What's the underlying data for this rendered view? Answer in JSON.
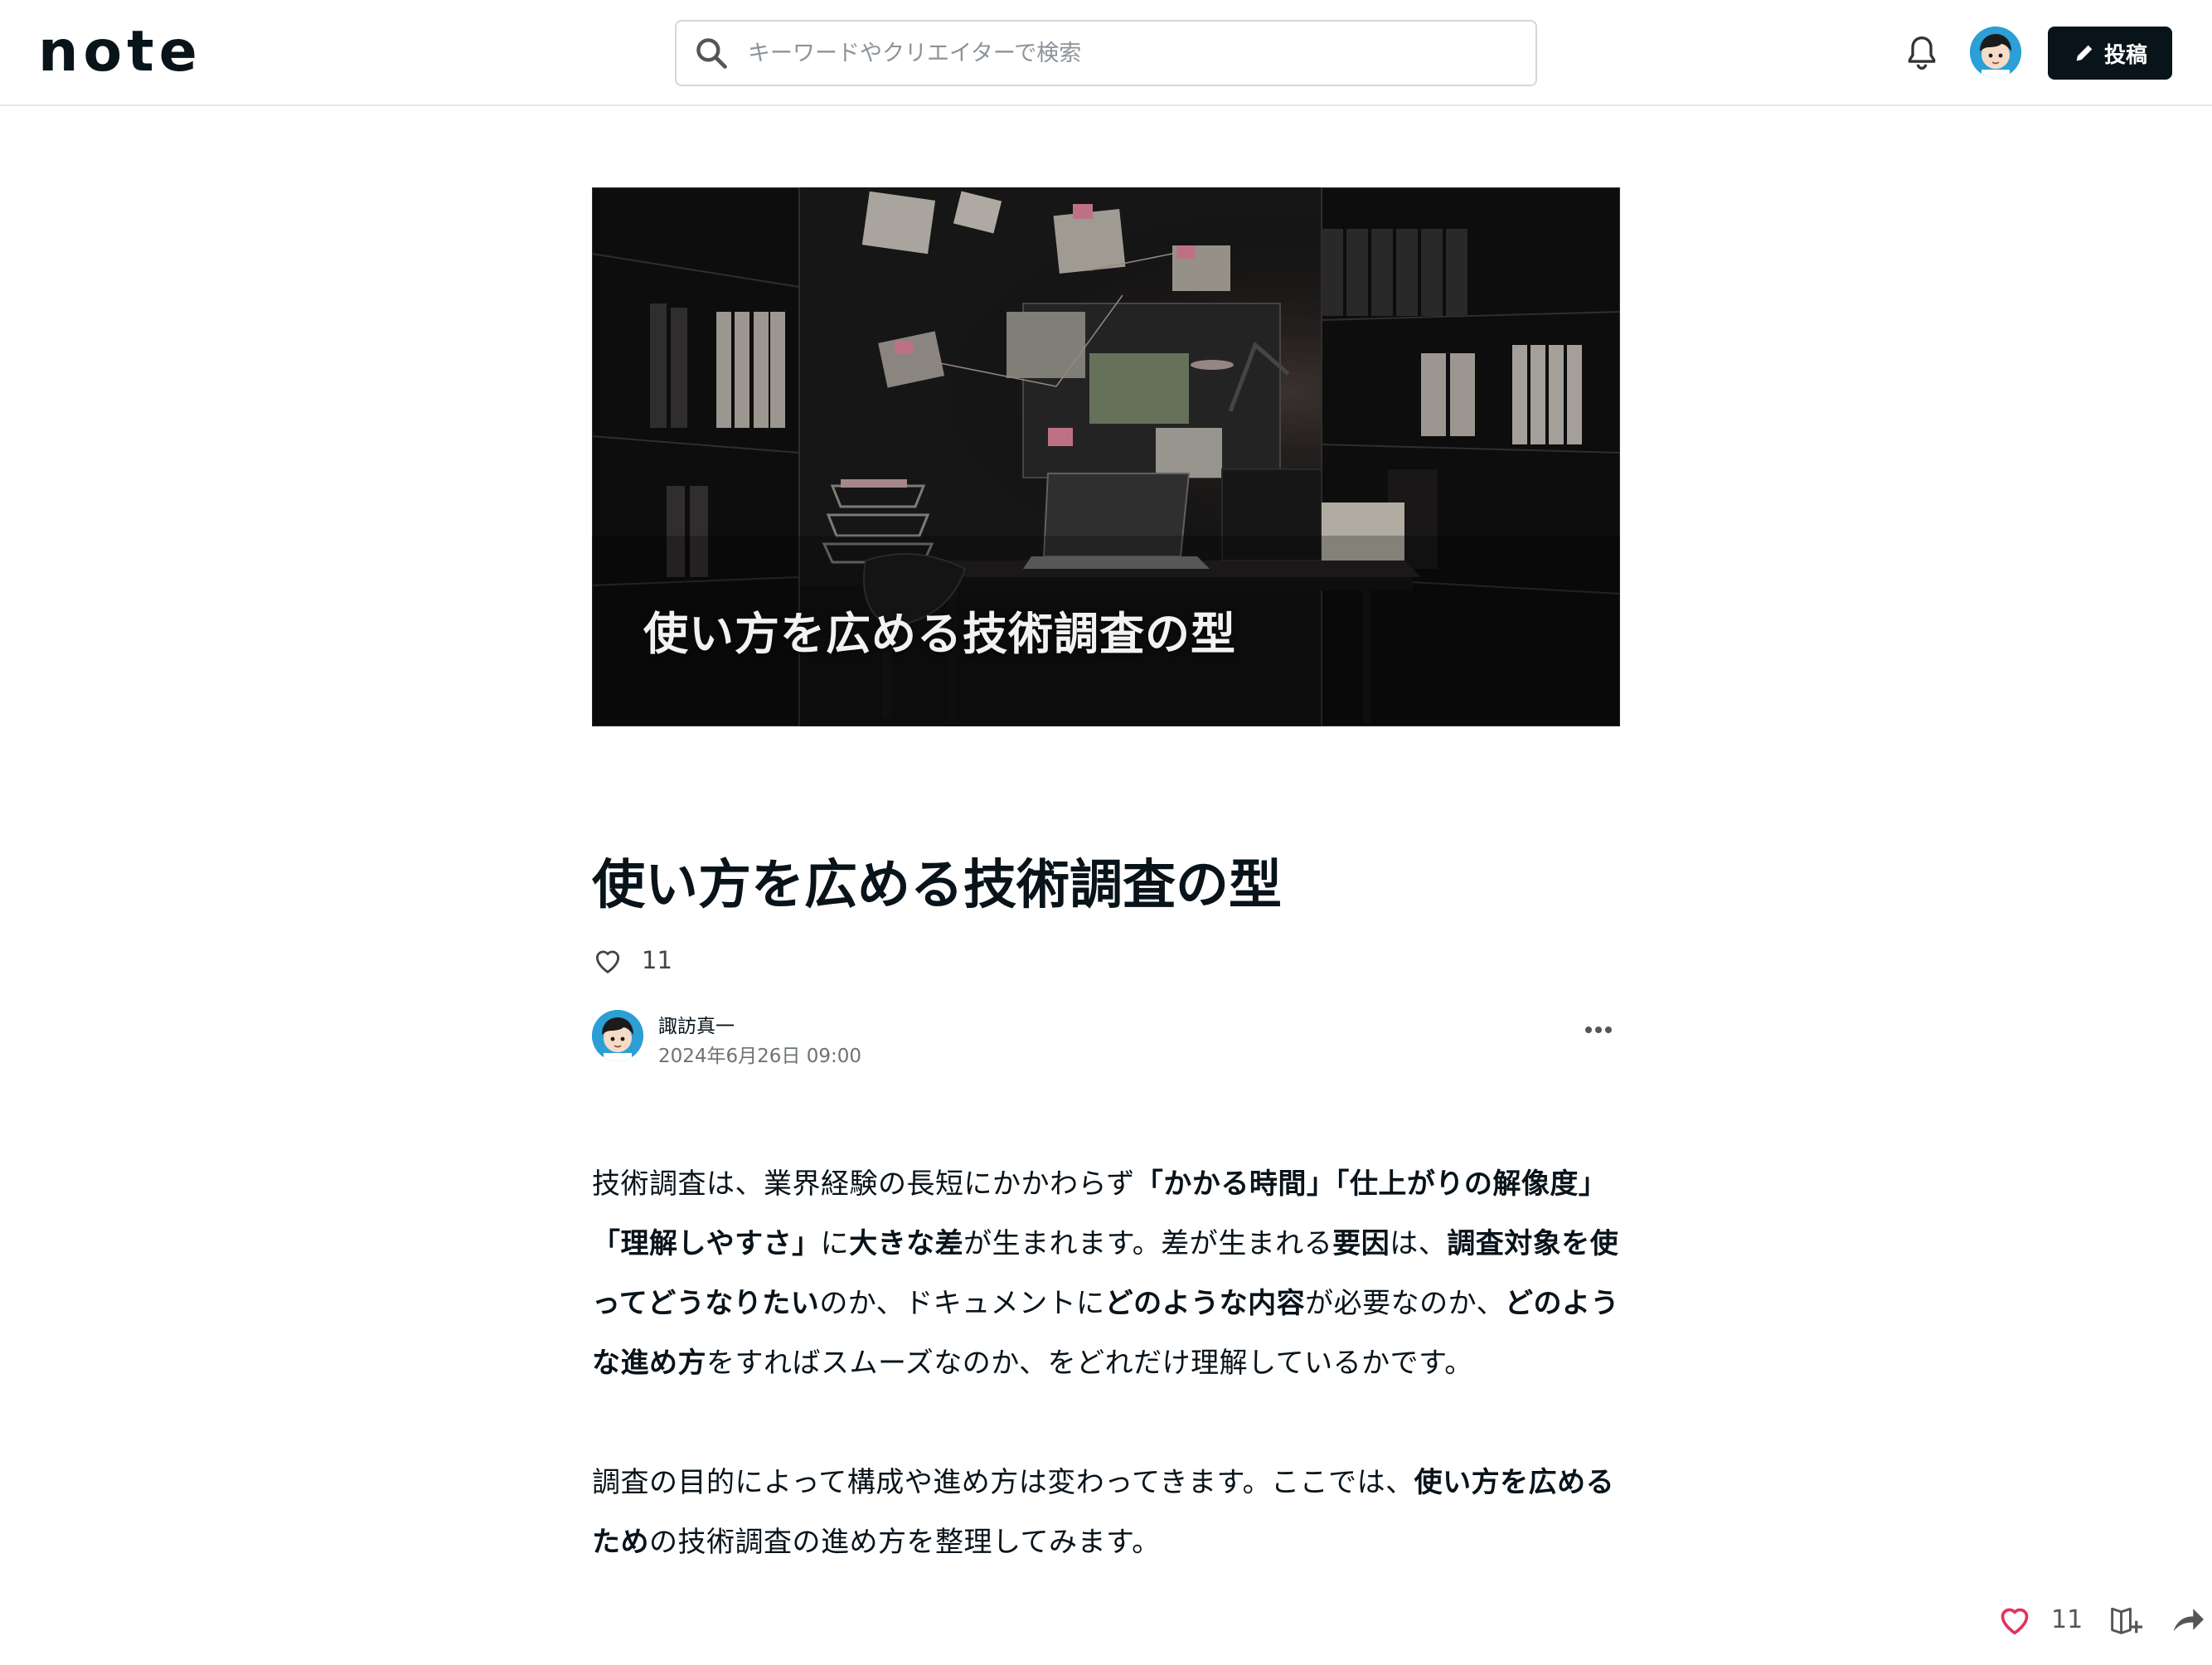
{
  "header": {
    "logo": "note",
    "search_placeholder": "キーワードやクリエイターで検索",
    "post_label": "投稿"
  },
  "article": {
    "hero_caption": "使い方を広める技術調査の型",
    "title": "使い方を広める技術調査の型",
    "like_count": "11",
    "author": {
      "name": "諏訪真一",
      "date": "2024年6月26日 09:00"
    },
    "paragraphs": [
      [
        {
          "t": "技術調査は、業界経験の長短にかかわらず",
          "b": false
        },
        {
          "t": "「かかる時間」「仕上がりの解像度」「理解しやすさ」",
          "b": true
        },
        {
          "t": "に",
          "b": false
        },
        {
          "t": "大きな差",
          "b": true
        },
        {
          "t": "が生まれます。差が生まれる",
          "b": false
        },
        {
          "t": "要因",
          "b": true
        },
        {
          "t": "は、",
          "b": false
        },
        {
          "t": "調査対象を使ってどうなりたい",
          "b": true
        },
        {
          "t": "のか、ドキュメントに",
          "b": false
        },
        {
          "t": "どのような内容",
          "b": true
        },
        {
          "t": "が必要なのか、",
          "b": false
        },
        {
          "t": "どのような進め方",
          "b": true
        },
        {
          "t": "をすればスムーズなのか、をどれだけ理解しているかです。",
          "b": false
        }
      ],
      [
        {
          "t": "調査の目的によって構成や進め方は変わってきます。ここでは、",
          "b": false
        },
        {
          "t": "使い方を広めるため",
          "b": true
        },
        {
          "t": "の技術調査の進め方を整理してみます。",
          "b": false
        }
      ]
    ]
  },
  "action_bar": {
    "like_count": "11"
  },
  "icons": {
    "search": "search-icon",
    "bell": "bell-icon",
    "pencil": "pencil-icon",
    "heart": "heart-icon",
    "more": "more-horizontal-icon",
    "magazine": "add-to-magazine-icon",
    "share": "share-icon"
  },
  "colors": {
    "text": "#08131a",
    "accent_heart": "#e3335a",
    "button_bg": "#08131a"
  }
}
